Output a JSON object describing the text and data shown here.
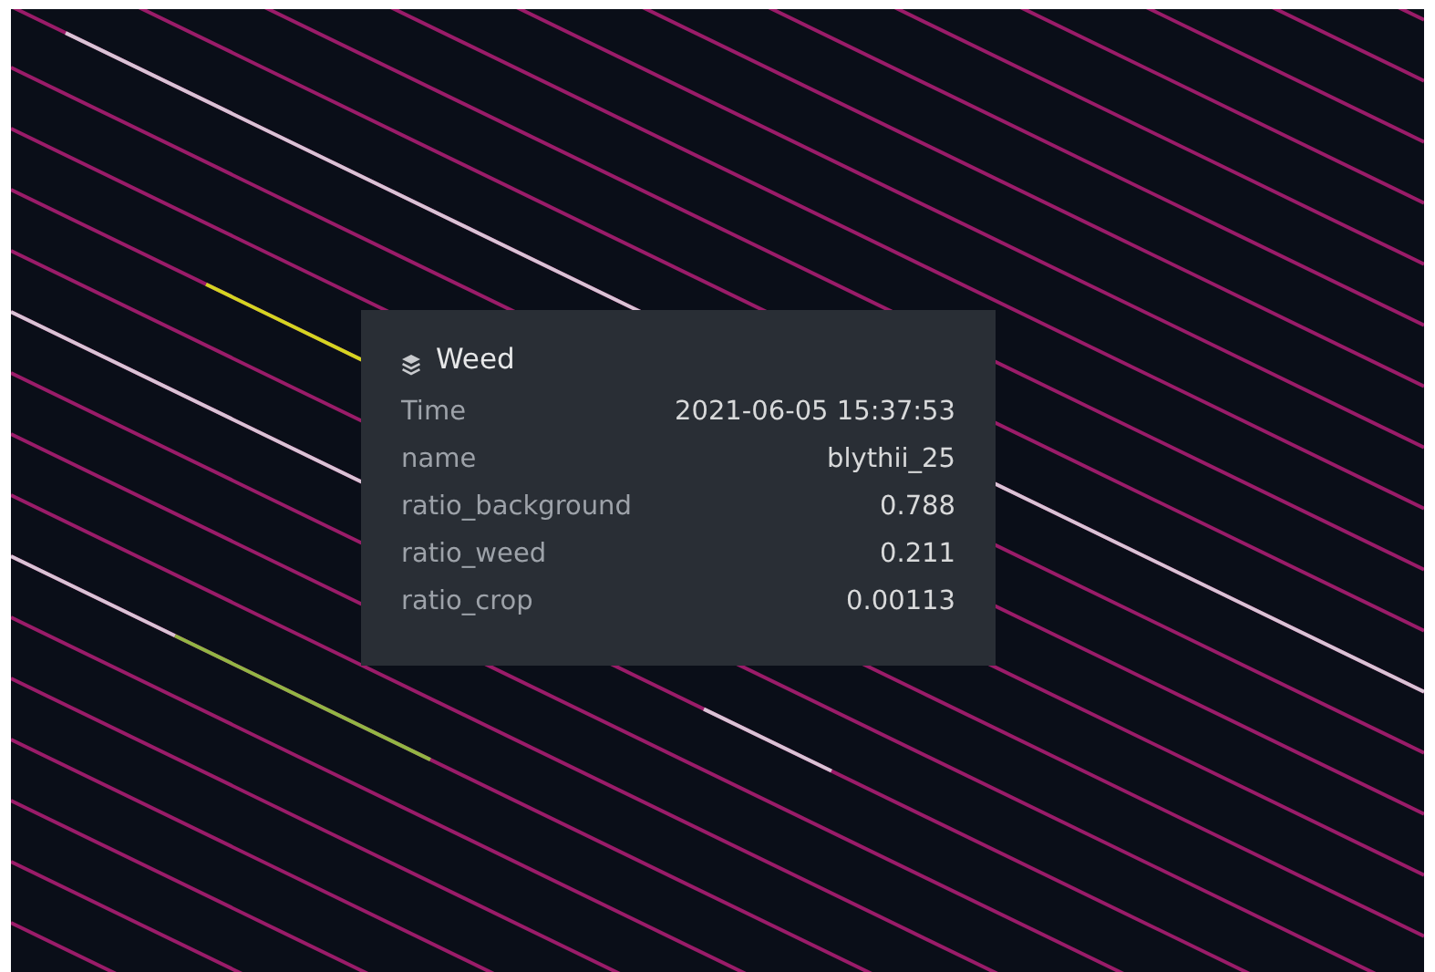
{
  "tooltip": {
    "title": "Weed",
    "rows": [
      {
        "label": "Time",
        "value": "2021-06-05 15:37:53"
      },
      {
        "label": "name",
        "value": "blythii_25"
      },
      {
        "label": "ratio_background",
        "value": "0.788"
      },
      {
        "label": "ratio_weed",
        "value": "0.211"
      },
      {
        "label": "ratio_crop",
        "value": "0.00113"
      }
    ]
  }
}
